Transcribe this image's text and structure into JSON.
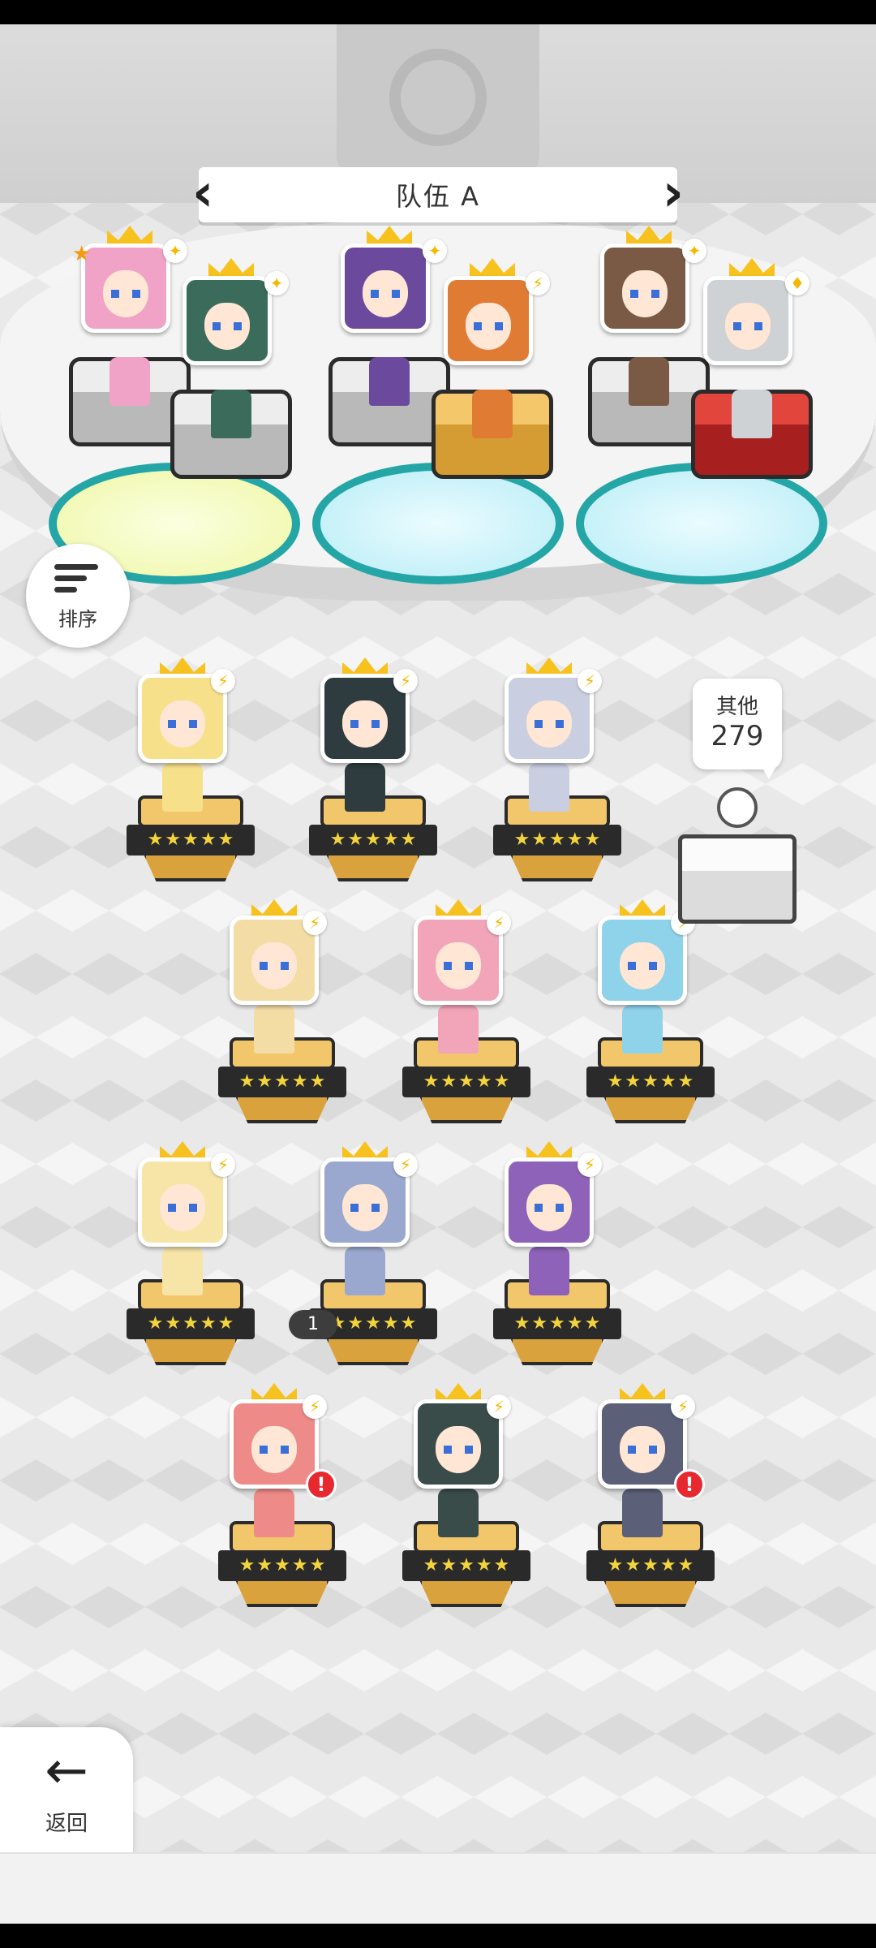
{
  "team": {
    "title": "队伍 A",
    "prev_icon": "chevron-left-icon",
    "next_icon": "chevron-right-icon"
  },
  "sort": {
    "label": "排序",
    "icon": "sort-icon"
  },
  "others": {
    "label": "其他",
    "count": "279"
  },
  "back": {
    "label": "返回",
    "icon": "arrow-left-icon"
  },
  "roster_stack_count": "1",
  "team_slots": [
    {
      "name": "slot-1",
      "pedestal": "grey",
      "badge": "sparkle",
      "favorite": true,
      "color": "#f0a3c6"
    },
    {
      "name": "slot-2",
      "pedestal": "grey",
      "badge": "sparkle",
      "favorite": false,
      "color": "#3b6b5a"
    },
    {
      "name": "slot-3",
      "pedestal": "grey",
      "badge": "sparkle",
      "favorite": false,
      "color": "#6b4a9e"
    },
    {
      "name": "slot-4",
      "pedestal": "gold",
      "badge": "lightning",
      "favorite": false,
      "color": "#e07b33"
    },
    {
      "name": "slot-5",
      "pedestal": "grey",
      "badge": "sparkle",
      "favorite": false,
      "color": "#7a5a45"
    },
    {
      "name": "slot-6",
      "pedestal": "red",
      "badge": "diamond",
      "favorite": false,
      "color": "#cfd2d4"
    }
  ],
  "heroes": [
    {
      "row": 1,
      "col": 1,
      "color": "#f7e08a",
      "alert": false,
      "stars": 5
    },
    {
      "row": 1,
      "col": 2,
      "color": "#2e3c3f",
      "alert": false,
      "stars": 5
    },
    {
      "row": 1,
      "col": 3,
      "color": "#c9cee0",
      "alert": false,
      "stars": 5
    },
    {
      "row": 2,
      "col": 1,
      "color": "#f4dda5",
      "alert": false,
      "stars": 5
    },
    {
      "row": 2,
      "col": 2,
      "color": "#f2a4b8",
      "alert": false,
      "stars": 5
    },
    {
      "row": 2,
      "col": 3,
      "color": "#8fd3ea",
      "alert": false,
      "stars": 5
    },
    {
      "row": 3,
      "col": 1,
      "color": "#f6e5a7",
      "alert": false,
      "stars": 5
    },
    {
      "row": 3,
      "col": 2,
      "color": "#9aa8cf",
      "alert": false,
      "stars": 5
    },
    {
      "row": 3,
      "col": 3,
      "color": "#8e62b8",
      "alert": false,
      "stars": 5
    },
    {
      "row": 4,
      "col": 1,
      "color": "#ee8a87",
      "alert": true,
      "stars": 5
    },
    {
      "row": 4,
      "col": 2,
      "color": "#3a4c4a",
      "alert": false,
      "stars": 5
    },
    {
      "row": 4,
      "col": 3,
      "color": "#5b5f78",
      "alert": true,
      "stars": 5
    }
  ],
  "colors": {
    "accent_gold": "#f7c21e",
    "pad_teal": "#25a6a6",
    "alert_red": "#e8282f"
  }
}
